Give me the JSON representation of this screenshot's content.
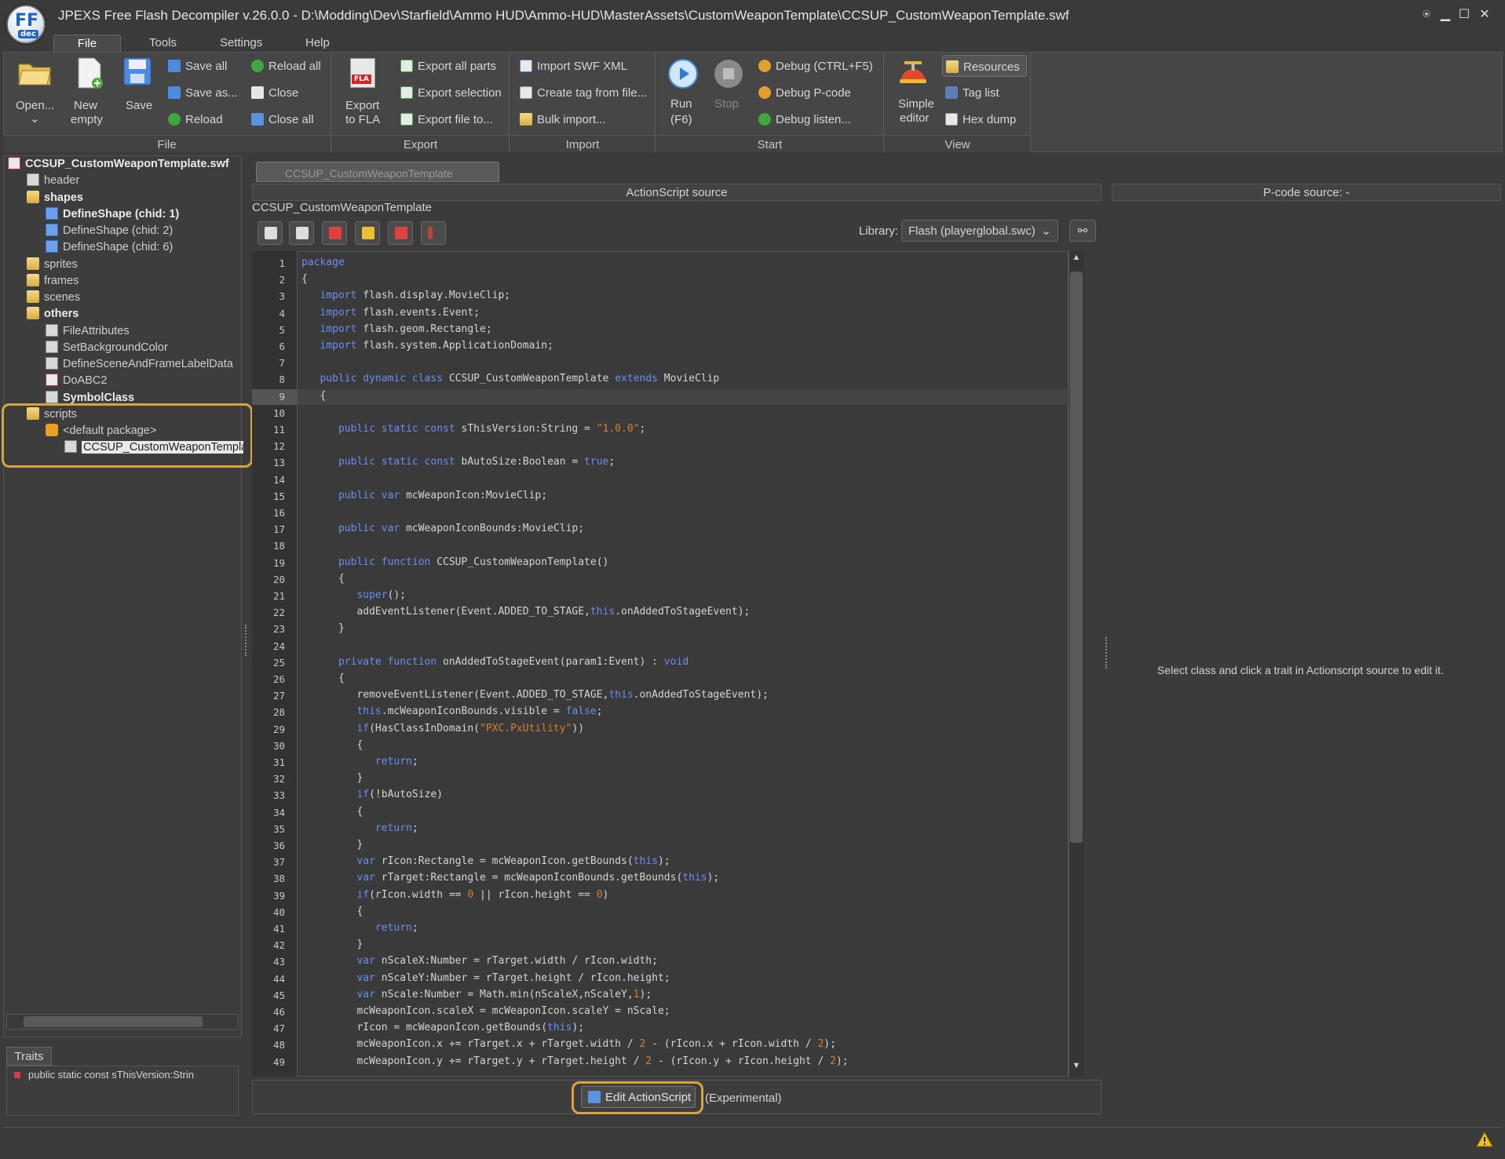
{
  "window": {
    "title": "JPEXS Free Flash Decompiler v.26.0.0 - D:\\Modding\\Dev\\Starfield\\Ammo HUD\\Ammo-HUD\\MasterAssets\\CustomWeaponTemplate\\CCSUP_CustomWeaponTemplate.swf",
    "logo_text": "FF",
    "logo_sub": "dec",
    "pin": "⍟",
    "minimize": "▁",
    "maximize": "☐",
    "close": "✕"
  },
  "menu": [
    "File",
    "Tools",
    "Settings",
    "Help"
  ],
  "ribbon": {
    "file": {
      "label": "File",
      "open": "Open...",
      "open_arrow": "⌄",
      "new_empty_1": "New",
      "new_empty_2": "empty",
      "save": "Save",
      "save_all": "Save all",
      "save_as": "Save as...",
      "reload": "Reload",
      "reload_all": "Reload all",
      "close": "Close",
      "close_all": "Close all"
    },
    "export": {
      "label": "Export",
      "export_fla_1": "Export",
      "export_fla_2": "to FLA",
      "fla_badge": "FLA",
      "export_all_parts": "Export all parts",
      "export_selection": "Export selection",
      "export_file_to": "Export file to..."
    },
    "import": {
      "label": "Import",
      "import_swf_xml": "Import SWF XML",
      "create_tag": "Create tag from file...",
      "bulk_import": "Bulk import..."
    },
    "start": {
      "label": "Start",
      "run_1": "Run",
      "run_2": "(F6)",
      "stop": "Stop",
      "debug": "Debug (CTRL+F5)",
      "debug_pcode": "Debug P-code",
      "debug_listen": "Debug listen..."
    },
    "view": {
      "label": "View",
      "simple_editor_1": "Simple",
      "simple_editor_2": "editor",
      "resources": "Resources",
      "tag_list": "Tag list",
      "hex_dump": "Hex dump"
    }
  },
  "tree": {
    "root": "CCSUP_CustomWeaponTemplate.swf",
    "header": "header",
    "shapes": "shapes",
    "shape1": "DefineShape (chid: 1)",
    "shape2": "DefineShape (chid: 2)",
    "shape3": "DefineShape (chid: 6)",
    "sprites": "sprites",
    "frames": "frames",
    "scenes": "scenes",
    "others": "others",
    "fileattr": "FileAttributes",
    "setbg": "SetBackgroundColor",
    "definescene": "DefineSceneAndFrameLabelData",
    "doabc2": "DoABC2",
    "symbolclass": "SymbolClass",
    "scripts": "scripts",
    "default_package": "<default package>",
    "script_file": "CCSUP_CustomWeaponTemplate"
  },
  "traits": {
    "tab": "Traits",
    "item": "public static const sThisVersion:Strin"
  },
  "editor": {
    "tab": "CCSUP_CustomWeaponTemplate",
    "header": "ActionScript source",
    "class_name": "CCSUP_CustomWeaponTemplate",
    "library_label": "Library:",
    "library_value": "Flash (playerglobal.swc)",
    "edit_button": "Edit ActionScript",
    "experimental": "(Experimental)"
  },
  "pcode": {
    "header": "P-code source: -",
    "hint": "Select class and click a trait in Actionscript source to edit it."
  },
  "code": [
    [
      [
        "k",
        "package"
      ]
    ],
    [
      [
        "t",
        "{"
      ]
    ],
    [
      [
        "t",
        "   "
      ],
      [
        "k",
        "import"
      ],
      [
        "t",
        " flash.display.MovieClip;"
      ]
    ],
    [
      [
        "t",
        "   "
      ],
      [
        "k",
        "import"
      ],
      [
        "t",
        " flash.events.Event;"
      ]
    ],
    [
      [
        "t",
        "   "
      ],
      [
        "k",
        "import"
      ],
      [
        "t",
        " flash.geom.Rectangle;"
      ]
    ],
    [
      [
        "t",
        "   "
      ],
      [
        "k",
        "import"
      ],
      [
        "t",
        " flash.system.ApplicationDomain;"
      ]
    ],
    [
      [
        "t",
        ""
      ]
    ],
    [
      [
        "t",
        "   "
      ],
      [
        "k",
        "public dynamic class"
      ],
      [
        "t",
        " CCSUP_CustomWeaponTemplate "
      ],
      [
        "k",
        "extends"
      ],
      [
        "t",
        " MovieClip"
      ]
    ],
    [
      [
        "t",
        "   {"
      ]
    ],
    [
      [
        "t",
        ""
      ]
    ],
    [
      [
        "t",
        "      "
      ],
      [
        "k",
        "public static const"
      ],
      [
        "t",
        " sThisVersion:String = "
      ],
      [
        "s",
        "\"1.0.0\""
      ],
      [
        "t",
        ";"
      ]
    ],
    [
      [
        "t",
        ""
      ]
    ],
    [
      [
        "t",
        "      "
      ],
      [
        "k",
        "public static const"
      ],
      [
        "t",
        " bAutoSize:Boolean = "
      ],
      [
        "k",
        "true"
      ],
      [
        "t",
        ";"
      ]
    ],
    [
      [
        "t",
        ""
      ]
    ],
    [
      [
        "t",
        "      "
      ],
      [
        "k",
        "public var"
      ],
      [
        "t",
        " mcWeaponIcon:MovieClip;"
      ]
    ],
    [
      [
        "t",
        ""
      ]
    ],
    [
      [
        "t",
        "      "
      ],
      [
        "k",
        "public var"
      ],
      [
        "t",
        " mcWeaponIconBounds:MovieClip;"
      ]
    ],
    [
      [
        "t",
        ""
      ]
    ],
    [
      [
        "t",
        "      "
      ],
      [
        "k",
        "public function"
      ],
      [
        "t",
        " CCSUP_CustomWeaponTemplate()"
      ]
    ],
    [
      [
        "t",
        "      {"
      ]
    ],
    [
      [
        "t",
        "         "
      ],
      [
        "k",
        "super"
      ],
      [
        "t",
        "();"
      ]
    ],
    [
      [
        "t",
        "         addEventListener(Event.ADDED_TO_STAGE,"
      ],
      [
        "k",
        "this"
      ],
      [
        "t",
        ".onAddedToStageEvent);"
      ]
    ],
    [
      [
        "t",
        "      }"
      ]
    ],
    [
      [
        "t",
        ""
      ]
    ],
    [
      [
        "t",
        "      "
      ],
      [
        "k",
        "private function"
      ],
      [
        "t",
        " onAddedToStageEvent(param1:Event) : "
      ],
      [
        "k",
        "void"
      ]
    ],
    [
      [
        "t",
        "      {"
      ]
    ],
    [
      [
        "t",
        "         removeEventListener(Event.ADDED_TO_STAGE,"
      ],
      [
        "k",
        "this"
      ],
      [
        "t",
        ".onAddedToStageEvent);"
      ]
    ],
    [
      [
        "t",
        "         "
      ],
      [
        "k",
        "this"
      ],
      [
        "t",
        ".mcWeaponIconBounds.visible = "
      ],
      [
        "k",
        "false"
      ],
      [
        "t",
        ";"
      ]
    ],
    [
      [
        "t",
        "         "
      ],
      [
        "k",
        "if"
      ],
      [
        "t",
        "(HasClassInDomain("
      ],
      [
        "s",
        "\"PXC.PxUtility\""
      ],
      [
        "t",
        "))"
      ]
    ],
    [
      [
        "t",
        "         {"
      ]
    ],
    [
      [
        "t",
        "            "
      ],
      [
        "k",
        "return"
      ],
      [
        "t",
        ";"
      ]
    ],
    [
      [
        "t",
        "         }"
      ]
    ],
    [
      [
        "t",
        "         "
      ],
      [
        "k",
        "if"
      ],
      [
        "t",
        "(!bAutoSize)"
      ]
    ],
    [
      [
        "t",
        "         {"
      ]
    ],
    [
      [
        "t",
        "            "
      ],
      [
        "k",
        "return"
      ],
      [
        "t",
        ";"
      ]
    ],
    [
      [
        "t",
        "         }"
      ]
    ],
    [
      [
        "t",
        "         "
      ],
      [
        "k",
        "var"
      ],
      [
        "t",
        " rIcon:Rectangle = mcWeaponIcon.getBounds("
      ],
      [
        "k",
        "this"
      ],
      [
        "t",
        ");"
      ]
    ],
    [
      [
        "t",
        "         "
      ],
      [
        "k",
        "var"
      ],
      [
        "t",
        " rTarget:Rectangle = mcWeaponIconBounds.getBounds("
      ],
      [
        "k",
        "this"
      ],
      [
        "t",
        ");"
      ]
    ],
    [
      [
        "t",
        "         "
      ],
      [
        "k",
        "if"
      ],
      [
        "t",
        "(rIcon.width == "
      ],
      [
        "s",
        "0"
      ],
      [
        "t",
        " || rIcon.height == "
      ],
      [
        "s",
        "0"
      ],
      [
        "t",
        ")"
      ]
    ],
    [
      [
        "t",
        "         {"
      ]
    ],
    [
      [
        "t",
        "            "
      ],
      [
        "k",
        "return"
      ],
      [
        "t",
        ";"
      ]
    ],
    [
      [
        "t",
        "         }"
      ]
    ],
    [
      [
        "t",
        "         "
      ],
      [
        "k",
        "var"
      ],
      [
        "t",
        " nScaleX:Number = rTarget.width / rIcon.width;"
      ]
    ],
    [
      [
        "t",
        "         "
      ],
      [
        "k",
        "var"
      ],
      [
        "t",
        " nScaleY:Number = rTarget.height / rIcon.height;"
      ]
    ],
    [
      [
        "t",
        "         "
      ],
      [
        "k",
        "var"
      ],
      [
        "t",
        " nScale:Number = Math.min(nScaleX,nScaleY,"
      ],
      [
        "s",
        "1"
      ],
      [
        "t",
        ");"
      ]
    ],
    [
      [
        "t",
        "         mcWeaponIcon.scaleX = mcWeaponIcon.scaleY = nScale;"
      ]
    ],
    [
      [
        "t",
        "         rIcon = mcWeaponIcon.getBounds("
      ],
      [
        "k",
        "this"
      ],
      [
        "t",
        ");"
      ]
    ],
    [
      [
        "t",
        "         mcWeaponIcon.x += rTarget.x + rTarget.width / "
      ],
      [
        "s",
        "2"
      ],
      [
        "t",
        " - (rIcon.x + rIcon.width / "
      ],
      [
        "s",
        "2"
      ],
      [
        "t",
        ");"
      ]
    ],
    [
      [
        "t",
        "         mcWeaponIcon.y += rTarget.y + rTarget.height / "
      ],
      [
        "s",
        "2"
      ],
      [
        "t",
        " - (rIcon.y + rIcon.height / "
      ],
      [
        "s",
        "2"
      ],
      [
        "t",
        ");"
      ]
    ]
  ]
}
